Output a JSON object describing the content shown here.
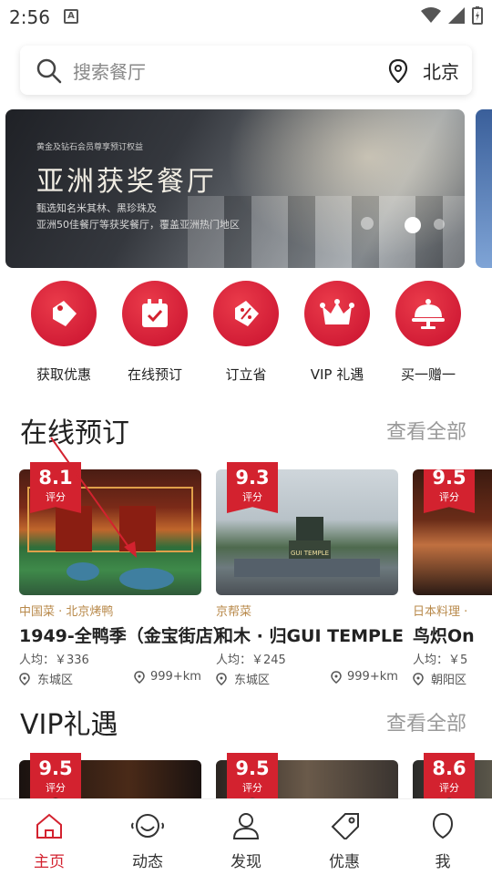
{
  "status_bar": {
    "time": "2:56",
    "a_badge": "A"
  },
  "search": {
    "placeholder": "搜索餐厅",
    "city": "北京"
  },
  "banner": {
    "small_text": "黄金及钻石会员尊享预订权益",
    "title": "亚洲获奖餐厅",
    "subtitle_line1": "甄选知名米其林、黑珍珠及",
    "subtitle_line2": "亚洲50佳餐厅等获奖餐厅，覆盖亚洲热门地区"
  },
  "categories": [
    {
      "label": "获取优惠",
      "icon": "coupon-tag-icon"
    },
    {
      "label": "在线预订",
      "icon": "calendar-check-icon"
    },
    {
      "label": "订立省",
      "icon": "discount-tag-icon"
    },
    {
      "label": "VIP 礼遇",
      "icon": "crown-icon"
    },
    {
      "label": "买一赠一",
      "icon": "cloche-icon"
    }
  ],
  "online_booking": {
    "title": "在线预订",
    "more": "查看全部",
    "restaurants": [
      {
        "score": "8.1",
        "score_label": "评分",
        "tag": "中国菜 · 北京烤鸭",
        "name": "1949-全鸭季（金宝街店）",
        "price": "人均：￥336",
        "district": "东城区",
        "distance": "999+km"
      },
      {
        "score": "9.3",
        "score_label": "评分",
        "tag": "京帮菜",
        "name": "和木 · 归GUI TEMPLE",
        "price": "人均：￥245",
        "district": "东城区",
        "distance": "999+km"
      },
      {
        "score": "9.5",
        "score_label": "评分",
        "tag": "日本料理 ·",
        "name": "鸟炽On",
        "price": "人均：￥5",
        "district": "朝阳区",
        "distance": ""
      }
    ],
    "card2_sign": "GUI TEMPLE"
  },
  "vip": {
    "title": "VIP礼遇",
    "more": "查看全部",
    "cards": [
      {
        "score": "9.5",
        "score_label": "评分"
      },
      {
        "score": "9.5",
        "score_label": "评分"
      },
      {
        "score": "8.6",
        "score_label": "评分"
      }
    ]
  },
  "bottom_nav": [
    {
      "label": "主页",
      "icon": "home-icon",
      "active": true
    },
    {
      "label": "动态",
      "icon": "smile-face-icon",
      "active": false
    },
    {
      "label": "发现",
      "icon": "user-icon",
      "active": false
    },
    {
      "label": "优惠",
      "icon": "tag-icon",
      "active": false
    },
    {
      "label": "我",
      "icon": "profile-icon",
      "active": false
    }
  ],
  "colors": {
    "accent": "#d3222f",
    "tag_gold": "#b8894a"
  }
}
